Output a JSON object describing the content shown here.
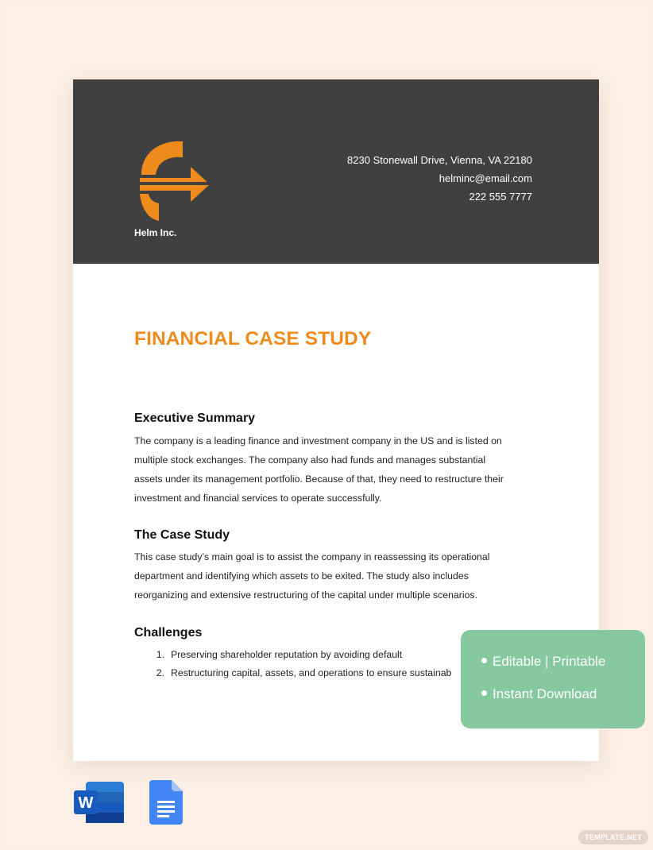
{
  "header": {
    "company": "Helm Inc.",
    "address": "8230 Stonewall Drive, Vienna, VA 22180",
    "email": "helminc@email.com",
    "phone": "222 555 7777"
  },
  "document": {
    "title": "FINANCIAL CASE STUDY",
    "sections": [
      {
        "heading": "Executive Summary",
        "lines": [
          "The company is a leading finance and investment company in the US and is listed on",
          "multiple stock exchanges. The company also had funds and manages substantial",
          "assets under its management portfolio. Because of that, they need to restructure their",
          "investment and financial services to operate successfully."
        ]
      },
      {
        "heading": "The Case Study",
        "lines": [
          "This case study’s main goal is to assist the company in reassessing its operational",
          "department and identifying which assets to be exited. The study also includes",
          "reorganizing and extensive restructuring of the capital under multiple scenarios."
        ]
      },
      {
        "heading": "Challenges",
        "items": [
          {
            "num": "1.",
            "text": "Preserving shareholder reputation by avoiding default"
          },
          {
            "num": "2.",
            "text": "Restructuring capital, assets, and operations to ensure sustainab"
          }
        ]
      }
    ]
  },
  "badge": {
    "line1": "Editable | Printable",
    "line2": "Instant Download",
    "color": "#86c99e"
  },
  "formats": {
    "word_icon": "microsoft-word-icon",
    "docs_icon": "google-docs-icon",
    "word_letter": "W"
  },
  "watermark": "TEMPLATE.NET",
  "colors": {
    "accent": "#ef8a1d",
    "header_bg": "#404040",
    "page_bg": "#fbeee3"
  }
}
